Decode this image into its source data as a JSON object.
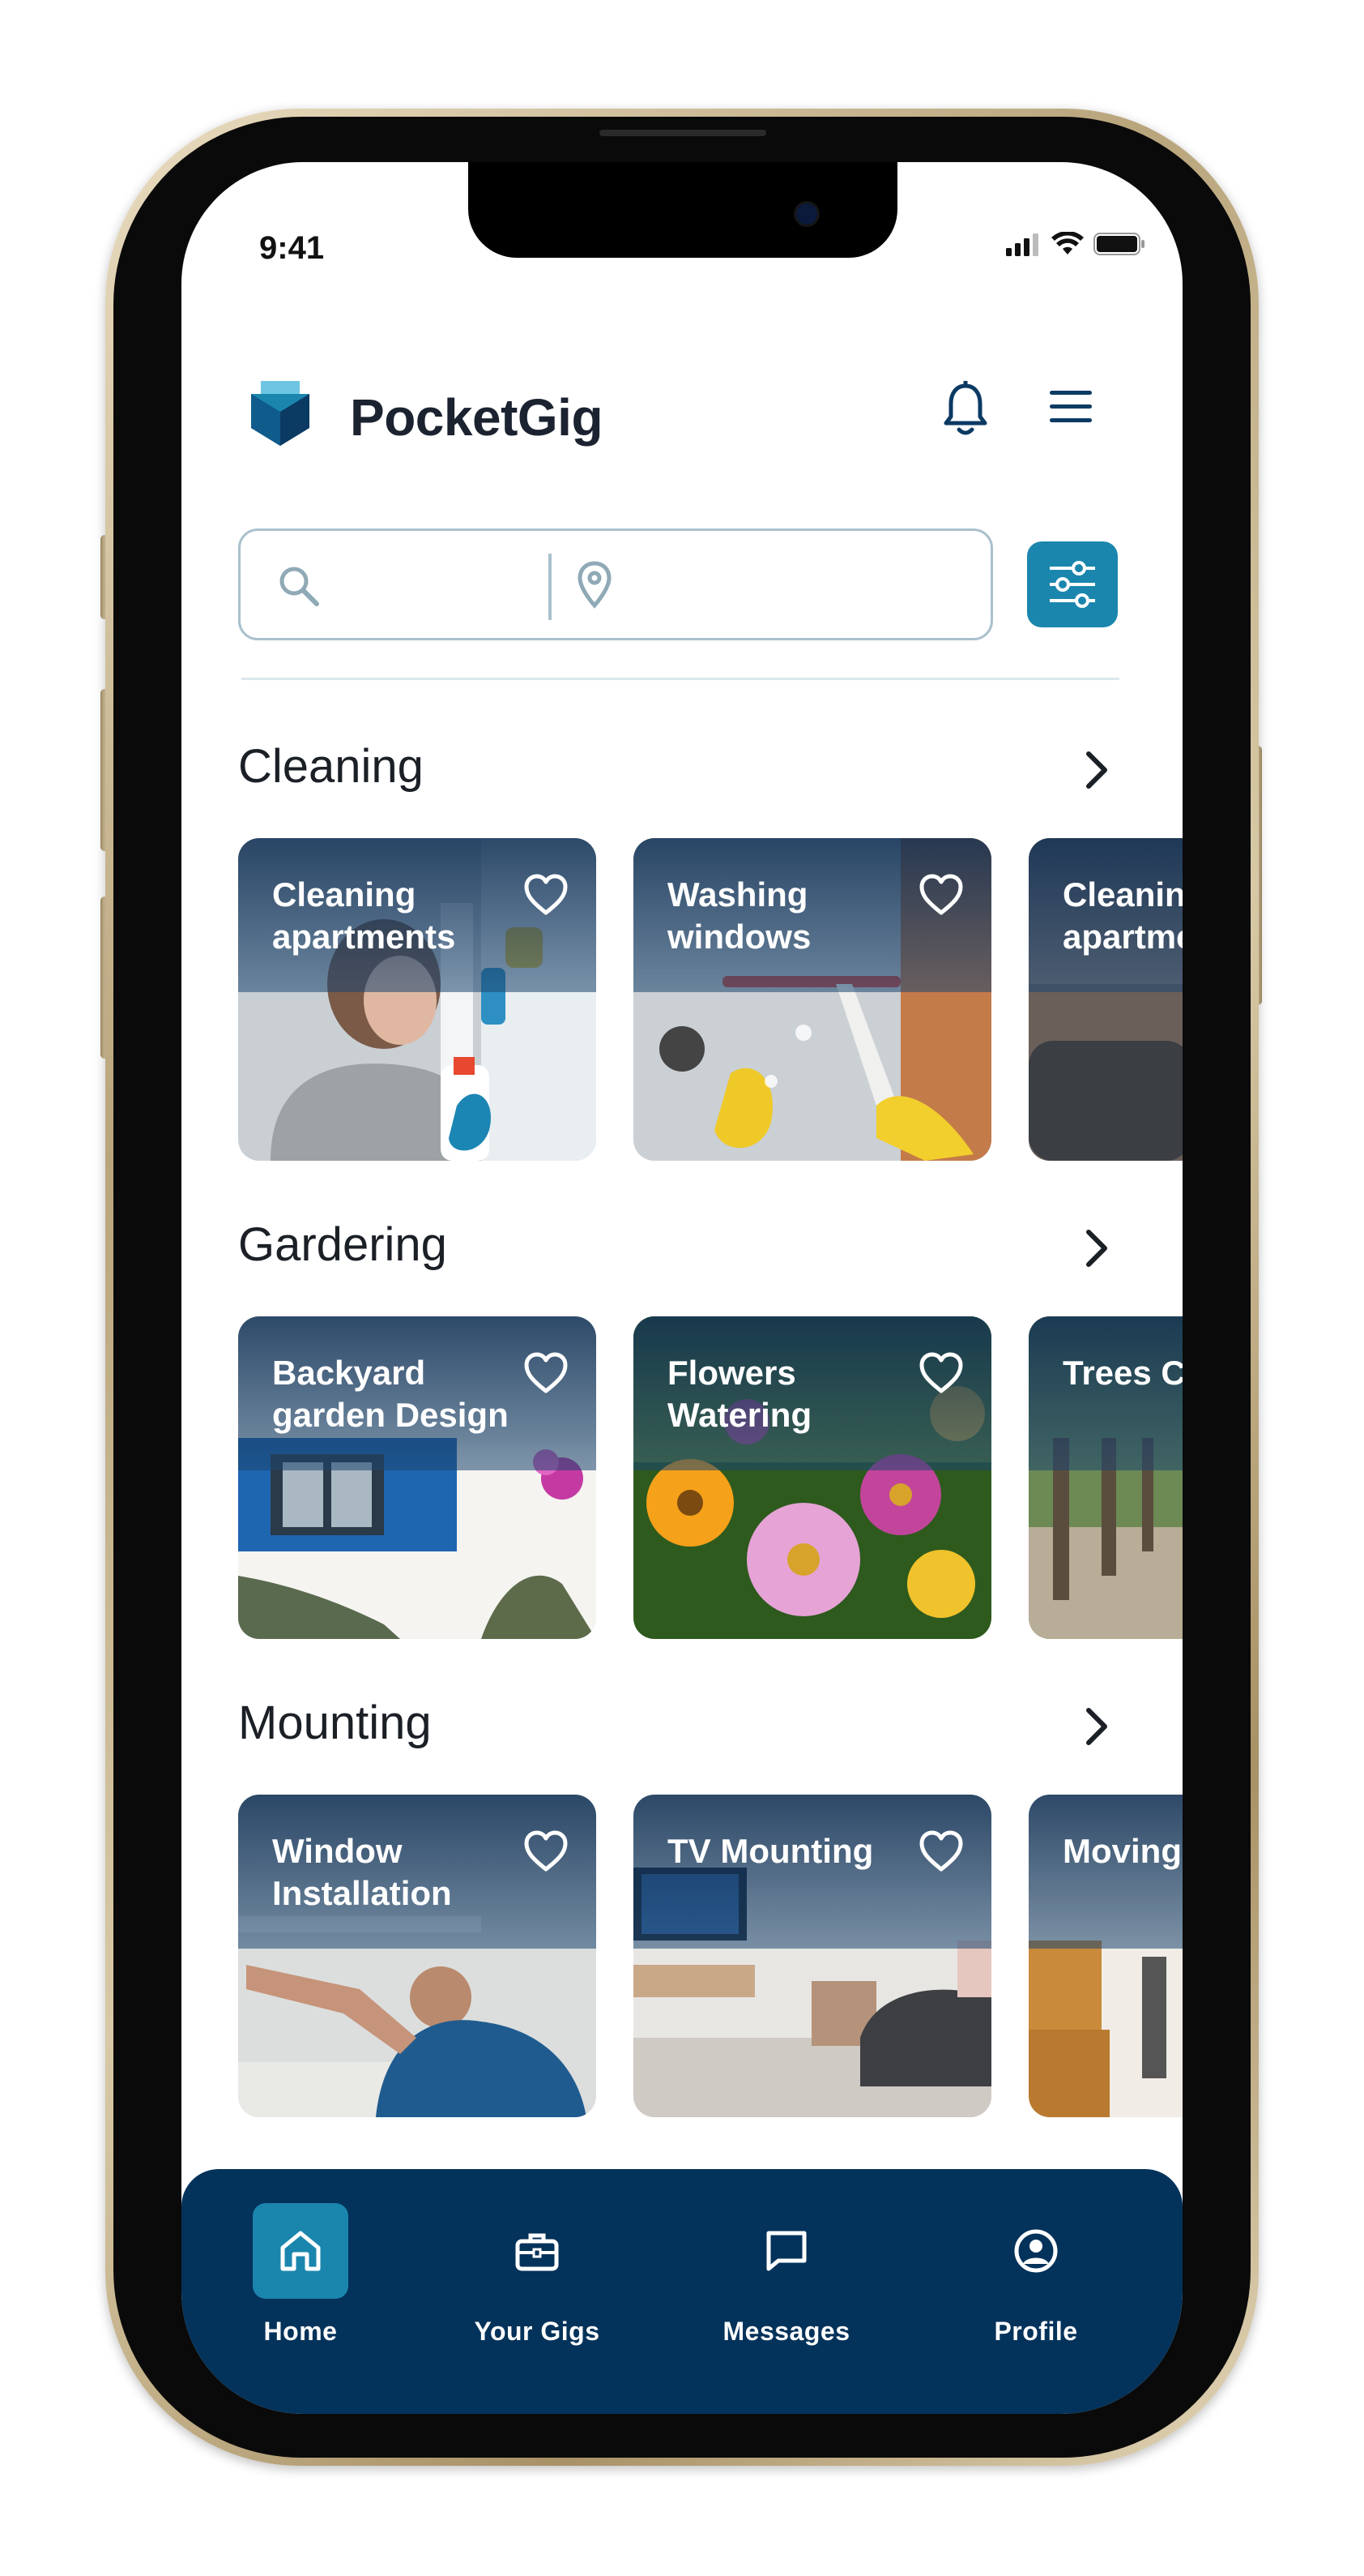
{
  "status_bar": {
    "time": "9:41"
  },
  "app": {
    "title": "PocketGig"
  },
  "search": {
    "query_placeholder": "",
    "location_placeholder": ""
  },
  "colors": {
    "brand_dark": "#03325a",
    "accent": "#1b86ad",
    "frame_gold": "#c8b58c"
  },
  "icons": {
    "logo": "pocketgig-logo-icon",
    "bell": "bell-icon",
    "menu": "hamburger-menu-icon",
    "search": "search-icon",
    "location": "location-pin-icon",
    "filter": "filter-sliders-icon",
    "heart": "heart-outline-icon",
    "chevron": "chevron-right-icon"
  },
  "sections": [
    {
      "title": "Cleaning",
      "cards": [
        {
          "label": "Cleaning apartments",
          "favorited": false
        },
        {
          "label": "Washing windows",
          "favorited": false
        },
        {
          "label": "Cleaning apartments",
          "favorited": false
        }
      ]
    },
    {
      "title": "Gardering",
      "cards": [
        {
          "label": "Backyard garden Design",
          "favorited": false
        },
        {
          "label": "Flowers Watering",
          "favorited": false
        },
        {
          "label": "Trees Cutting",
          "favorited": false
        }
      ]
    },
    {
      "title": "Mounting",
      "cards": [
        {
          "label": "Window Installation",
          "favorited": false
        },
        {
          "label": "TV Mounting",
          "favorited": false
        },
        {
          "label": "Moving boxes",
          "favorited": false
        }
      ]
    }
  ],
  "nav": {
    "items": [
      {
        "label": "Home",
        "icon": "home-icon",
        "active": true
      },
      {
        "label": "Your Gigs",
        "icon": "briefcase-icon",
        "active": false
      },
      {
        "label": "Messages",
        "icon": "chat-bubble-icon",
        "active": false
      },
      {
        "label": "Profile",
        "icon": "profile-circle-icon",
        "active": false
      }
    ]
  }
}
